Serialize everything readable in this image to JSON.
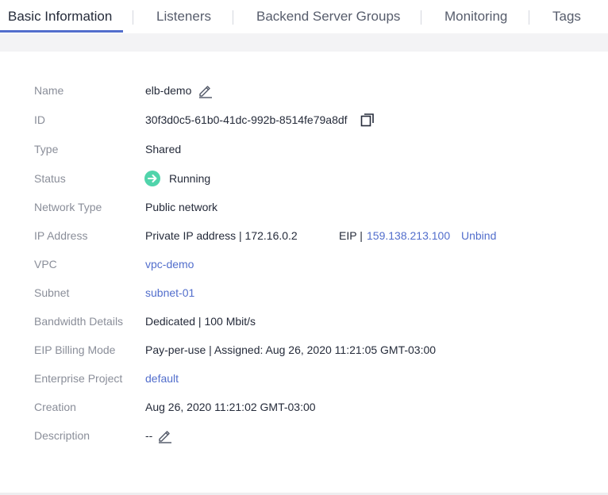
{
  "tabs": [
    "Basic Information",
    "Listeners",
    "Backend Server Groups",
    "Monitoring",
    "Tags"
  ],
  "details": {
    "name": {
      "label": "Name",
      "value": "elb-demo"
    },
    "id": {
      "label": "ID",
      "value": "30f3d0c5-61b0-41dc-992b-8514fe79a8df"
    },
    "type": {
      "label": "Type",
      "value": "Shared"
    },
    "status": {
      "label": "Status",
      "value": "Running"
    },
    "network_type": {
      "label": "Network Type",
      "value": "Public network"
    },
    "ip_address": {
      "label": "IP Address",
      "private": "Private IP address | 172.16.0.2",
      "eip_prefix": "EIP |",
      "eip": "159.138.213.100",
      "unbind": "Unbind"
    },
    "vpc": {
      "label": "VPC",
      "value": "vpc-demo"
    },
    "subnet": {
      "label": "Subnet",
      "value": "subnet-01"
    },
    "bandwidth": {
      "label": "Bandwidth Details",
      "value": "Dedicated | 100 Mbit/s"
    },
    "eip_billing": {
      "label": "EIP Billing Mode",
      "value": "Pay-per-use | Assigned: Aug 26, 2020 11:21:05 GMT-03:00"
    },
    "enterprise_project": {
      "label": "Enterprise Project",
      "value": "default"
    },
    "creation": {
      "label": "Creation",
      "value": "Aug 26, 2020 11:21:02 GMT-03:00"
    },
    "description": {
      "label": "Description",
      "value": "--"
    }
  },
  "icons": {
    "edit": "pencil-edit-icon",
    "copy": "copy-icon",
    "status": "running-arrow-icon"
  },
  "colors": {
    "accent": "#526ecc",
    "label": "#8a8e99",
    "text": "#252b3a",
    "running": "#50d4ab"
  }
}
